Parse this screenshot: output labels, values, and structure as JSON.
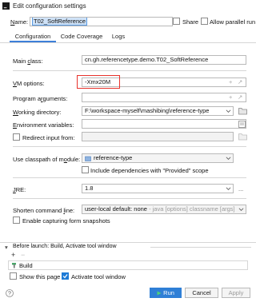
{
  "window": {
    "title": "Edit configuration settings"
  },
  "header": {
    "name_label": "Name:",
    "name_value": "T02_SoftReference",
    "share_label": "Share",
    "share_checked": false,
    "parallel_label": "Allow parallel run",
    "parallel_checked": false
  },
  "tabs": [
    {
      "label": "Configuration",
      "active": true
    },
    {
      "label": "Code Coverage",
      "active": false
    },
    {
      "label": "Logs",
      "active": false
    }
  ],
  "form": {
    "main_class_label": "Main class:",
    "main_class_value": "cn.gh.referencetype.demo.T02_SoftReference",
    "vm_options_label": "VM options:",
    "vm_options_value": "-Xmx20M",
    "program_args_label": "Program arguments:",
    "program_args_value": "",
    "working_dir_label": "Working directory:",
    "working_dir_value": "F:\\workspace-myself\\mashibing\\reference-type",
    "env_vars_label": "Environment variables:",
    "env_vars_value": "",
    "redirect_label": "Redirect input from:",
    "redirect_checked": false,
    "classpath_label": "Use classpath of module:",
    "classpath_value": "reference-type",
    "include_provided_label": "Include dependencies with \"Provided\" scope",
    "include_provided_checked": false,
    "jre_label": "JRE:",
    "jre_value": "1.8",
    "shorten_label": "Shorten command line:",
    "shorten_value": "user-local default: none",
    "shorten_hint": "- java [options] classname [args]",
    "capture_label": "Enable capturing form snapshots",
    "capture_checked": false
  },
  "before_launch": {
    "header": "Before launch: Build, Activate tool window",
    "add_symbol": "+",
    "remove_symbol": "−",
    "items": [
      "Build"
    ],
    "show_page_label": "Show this page",
    "show_page_checked": false,
    "activate_label": "Activate tool window",
    "activate_checked": true
  },
  "buttons": {
    "run_label": "Run",
    "cancel_label": "Cancel",
    "apply_label": "Apply"
  },
  "colors": {
    "accent": "#2f7fd6",
    "annotation": "#e8322c",
    "selection": "#cfe2f7"
  },
  "icons": {
    "title": "intellij-logo-icon",
    "help": "question-icon",
    "run": "run-triangle-icon",
    "build": "build-hammer-icon",
    "module": "module-folder-icon"
  }
}
